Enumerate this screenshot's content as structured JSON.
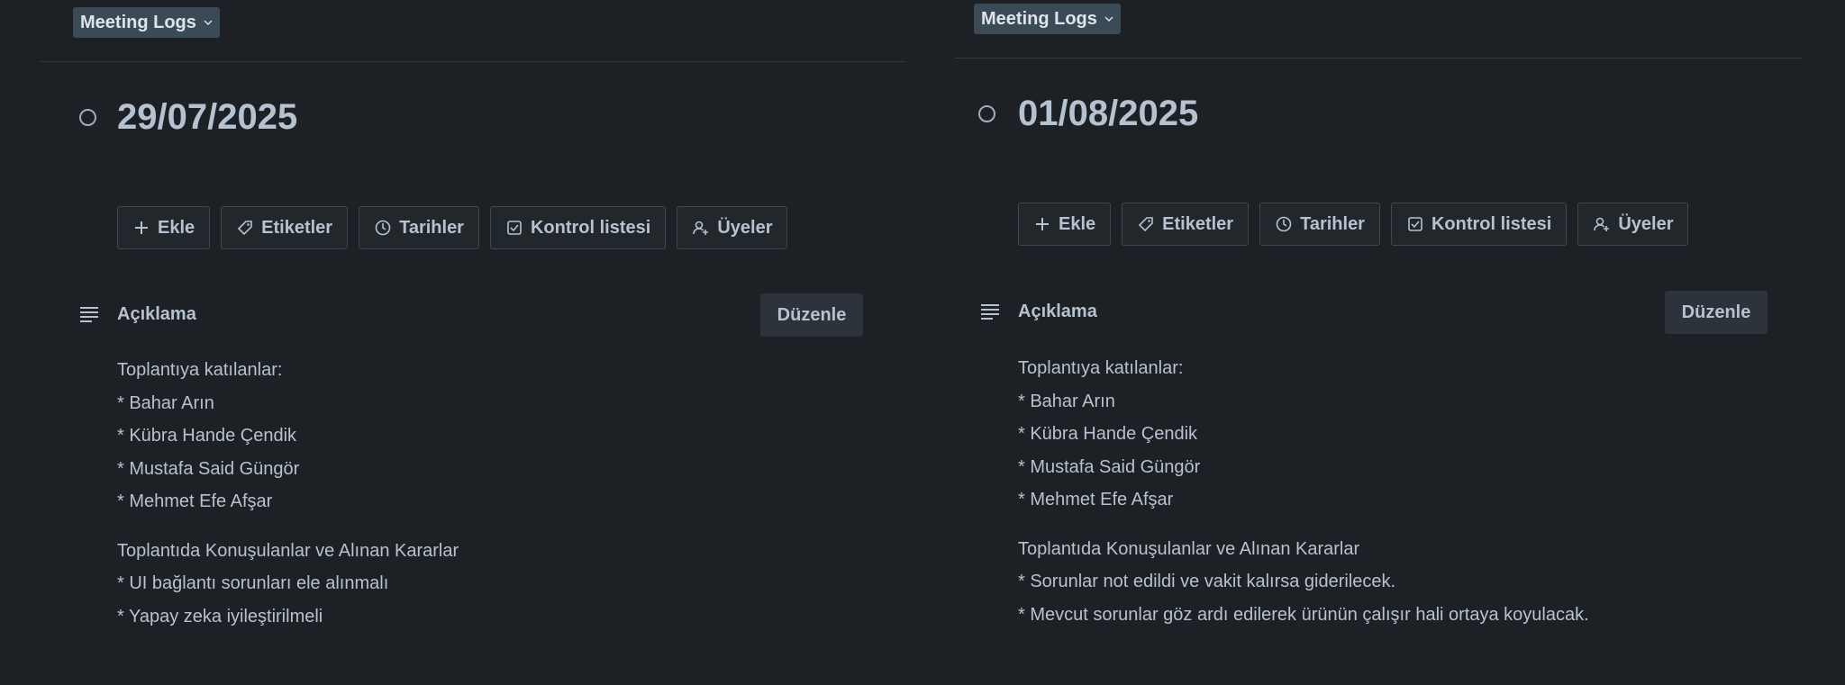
{
  "cards": [
    {
      "list_name": "Meeting Logs",
      "title": "29/07/2025",
      "actions": [
        {
          "label": "Ekle",
          "icon": "plus-icon"
        },
        {
          "label": "Etiketler",
          "icon": "tag-icon"
        },
        {
          "label": "Tarihler",
          "icon": "clock-icon"
        },
        {
          "label": "Kontrol listesi",
          "icon": "checklist-icon"
        },
        {
          "label": "Üyeler",
          "icon": "add-member-icon"
        }
      ],
      "description_heading": "Açıklama",
      "edit_label": "Düzenle",
      "attendees_heading": "Toplantıya katılanlar:",
      "attendees": [
        "* Bahar Arın",
        "* Kübra Hande Çendik",
        "* Mustafa Said Güngör",
        "* Mehmet Efe Afşar"
      ],
      "decisions_heading": "Toplantıda Konuşulanlar ve Alınan Kararlar",
      "decisions": [
        "* UI bağlantı sorunları ele alınmalı",
        "* Yapay zeka iyileştirilmeli"
      ]
    },
    {
      "list_name": "Meeting Logs",
      "title": "01/08/2025",
      "actions": [
        {
          "label": "Ekle",
          "icon": "plus-icon"
        },
        {
          "label": "Etiketler",
          "icon": "tag-icon"
        },
        {
          "label": "Tarihler",
          "icon": "clock-icon"
        },
        {
          "label": "Kontrol listesi",
          "icon": "checklist-icon"
        },
        {
          "label": "Üyeler",
          "icon": "add-member-icon"
        }
      ],
      "description_heading": "Açıklama",
      "edit_label": "Düzenle",
      "attendees_heading": "Toplantıya katılanlar:",
      "attendees": [
        "* Bahar Arın",
        "* Kübra Hande Çendik",
        "* Mustafa Said Güngör",
        "* Mehmet Efe Afşar"
      ],
      "decisions_heading": "Toplantıda Konuşulanlar ve Alınan Kararlar",
      "decisions": [
        "* Sorunlar not edildi ve vakit kalırsa giderilecek.",
        "* Mevcut sorunlar göz ardı edilerek ürünün çalışır hali ortaya koyulacak."
      ]
    }
  ],
  "colors": {
    "background": "#1d2125",
    "text": "#b6c2cf",
    "badge": "#3b4a57",
    "button_border": "#3c474f",
    "edit_button": "#2c333a"
  }
}
